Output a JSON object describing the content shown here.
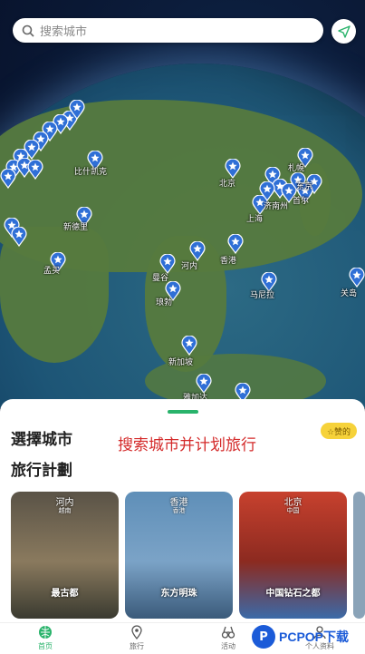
{
  "search": {
    "placeholder": "搜索城市"
  },
  "map_labels": {
    "harbin": "札幌",
    "beijing": "北京",
    "shanghai": "上海",
    "jinan": "济南州",
    "seoul": "首尔",
    "guangzhou": "香港",
    "hanoi": "河内",
    "bangkok": "曼谷",
    "vientiane": "琅勃",
    "newdelhi": "新德里",
    "mumbai": "孟买",
    "singapore": "新加坡",
    "jakarta": "雅加达",
    "koror": "马尼拉",
    "guam": "关岛",
    "astana": "比什凯克",
    "tokyo": "东京"
  },
  "sheet": {
    "title1": "選擇城市",
    "title2": "旅行計劃",
    "promo": "搜索城市并计划旅行",
    "badge": "☆赞的"
  },
  "cards": [
    {
      "city": "河内",
      "country": "越南",
      "caption": "最古都",
      "colors": [
        "#5a5347",
        "#8a7a5e",
        "#3a3a30"
      ]
    },
    {
      "city": "香港",
      "country": "香港",
      "caption": "东方明珠",
      "colors": [
        "#5f8fb8",
        "#7ba3c7",
        "#3a5a7a"
      ]
    },
    {
      "city": "北京",
      "country": "中国",
      "caption": "中国钻石之都",
      "colors": [
        "#c7412e",
        "#8c2a20",
        "#3b6aa8"
      ]
    }
  ],
  "tabs": [
    {
      "label": "首页",
      "icon": "globe-icon",
      "active": true
    },
    {
      "label": "旅行",
      "icon": "pin-icon",
      "active": false
    },
    {
      "label": "活动",
      "icon": "binoculars-icon",
      "active": false
    },
    {
      "label": "个人资料",
      "icon": "person-icon",
      "active": false
    }
  ],
  "watermark": {
    "logo": "P",
    "text": "PCPOP下载"
  },
  "colors": {
    "accent": "#29b36b",
    "promo": "#d42a2a",
    "pin": "#2f6fd6"
  }
}
